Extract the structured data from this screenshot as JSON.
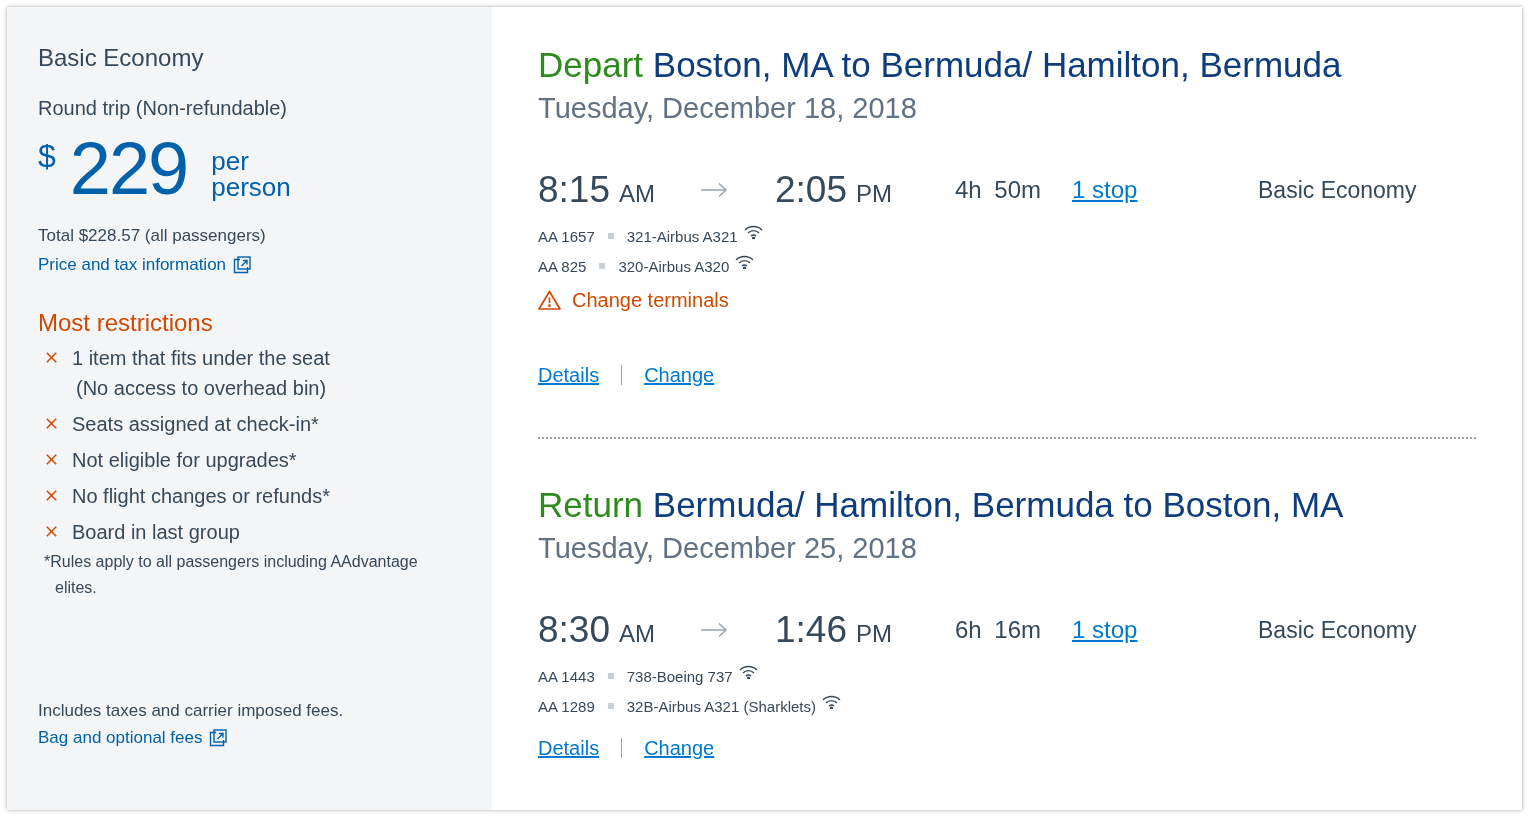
{
  "fare": {
    "title": "Basic Economy",
    "trip_type": "Round trip (Non-refundable)",
    "currency": "$",
    "amount": "229",
    "price_unit": "per person",
    "total": "Total $228.57 (all passengers)",
    "price_link": "Price and tax information",
    "restrictions": {
      "title": "Most restrictions",
      "items": [
        {
          "text": "1 item that fits under the seat",
          "note": "(No access to overhead bin)"
        },
        {
          "text": "Seats assigned at check-in*"
        },
        {
          "text": "Not eligible for upgrades*"
        },
        {
          "text": "No flight changes or refunds*"
        },
        {
          "text": "Board in last group"
        }
      ],
      "footnote": "*Rules apply to all passengers including AAdvantage elites."
    },
    "fees_note": "Includes taxes and carrier imposed fees.",
    "fees_link": "Bag and optional fees"
  },
  "slices": [
    {
      "label": "Depart",
      "route": "Boston, MA to Bermuda/ Hamilton, Bermuda",
      "date": "Tuesday, December 18, 2018",
      "depart": {
        "time": "8:15",
        "period": "AM"
      },
      "arrive": {
        "time": "2:05",
        "period": "PM"
      },
      "duration": "4h 50m",
      "stops": "1 stop",
      "cabin": "Basic Economy",
      "segments": [
        {
          "flight": "AA 1657",
          "aircraft": "321-Airbus A321",
          "wifi": true
        },
        {
          "flight": "AA 825",
          "aircraft": "320-Airbus A320",
          "wifi": true
        }
      ],
      "alerts": [
        {
          "kind": "warning",
          "text": "Change terminals"
        }
      ],
      "links": [
        "Details",
        "Change"
      ]
    },
    {
      "label": "Return",
      "route": "Bermuda/ Hamilton, Bermuda to Boston, MA",
      "date": "Tuesday, December 25, 2018",
      "depart": {
        "time": "8:30",
        "period": "AM"
      },
      "arrive": {
        "time": "1:46",
        "period": "PM"
      },
      "duration": "6h 16m",
      "stops": "1 stop",
      "cabin": "Basic Economy",
      "segments": [
        {
          "flight": "AA 1443",
          "aircraft": "738-Boeing 737",
          "wifi": true
        },
        {
          "flight": "AA 1289",
          "aircraft": "32B-Airbus A321 (Sharklets)",
          "wifi": true
        }
      ],
      "links": [
        "Details",
        "Change"
      ]
    }
  ]
}
